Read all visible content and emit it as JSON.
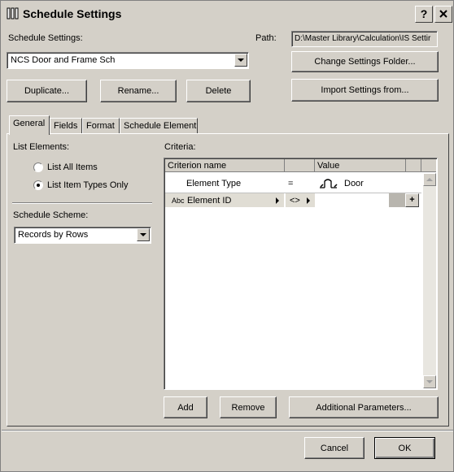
{
  "window": {
    "title": "Schedule Settings",
    "help_label": "?",
    "close_label": "✕"
  },
  "settings": {
    "label": "Schedule Settings:",
    "selected": "NCS Door and Frame Sch",
    "path_label": "Path:",
    "path_value": "D:\\Master Library\\Calculation\\IS Settir"
  },
  "buttons": {
    "duplicate": "Duplicate...",
    "rename": "Rename...",
    "delete": "Delete",
    "change_folder": "Change Settings Folder...",
    "import": "Import Settings from...",
    "add": "Add",
    "remove": "Remove",
    "additional": "Additional Parameters...",
    "cancel": "Cancel",
    "ok": "OK"
  },
  "tabs": [
    {
      "label": "General",
      "active": true
    },
    {
      "label": "Fields",
      "active": false
    },
    {
      "label": "Format",
      "active": false
    },
    {
      "label": "Schedule Element",
      "active": false
    }
  ],
  "list_elements": {
    "label": "List Elements:",
    "options": [
      {
        "label": "List All Items",
        "checked": false
      },
      {
        "label": "List Item Types Only",
        "checked": true
      }
    ]
  },
  "scheme": {
    "label": "Schedule Scheme:",
    "selected": "Records by Rows"
  },
  "criteria": {
    "label": "Criteria:",
    "headers": {
      "name": "Criterion name",
      "value": "Value"
    },
    "rows": [
      {
        "prefix": "",
        "name": "Element Type",
        "operator": "=",
        "value": "Door",
        "icon": "door-icon"
      },
      {
        "prefix": "Abc",
        "name": "Element ID",
        "operator": "<>",
        "value": "",
        "icon": ""
      }
    ],
    "add_symbol": "+"
  }
}
